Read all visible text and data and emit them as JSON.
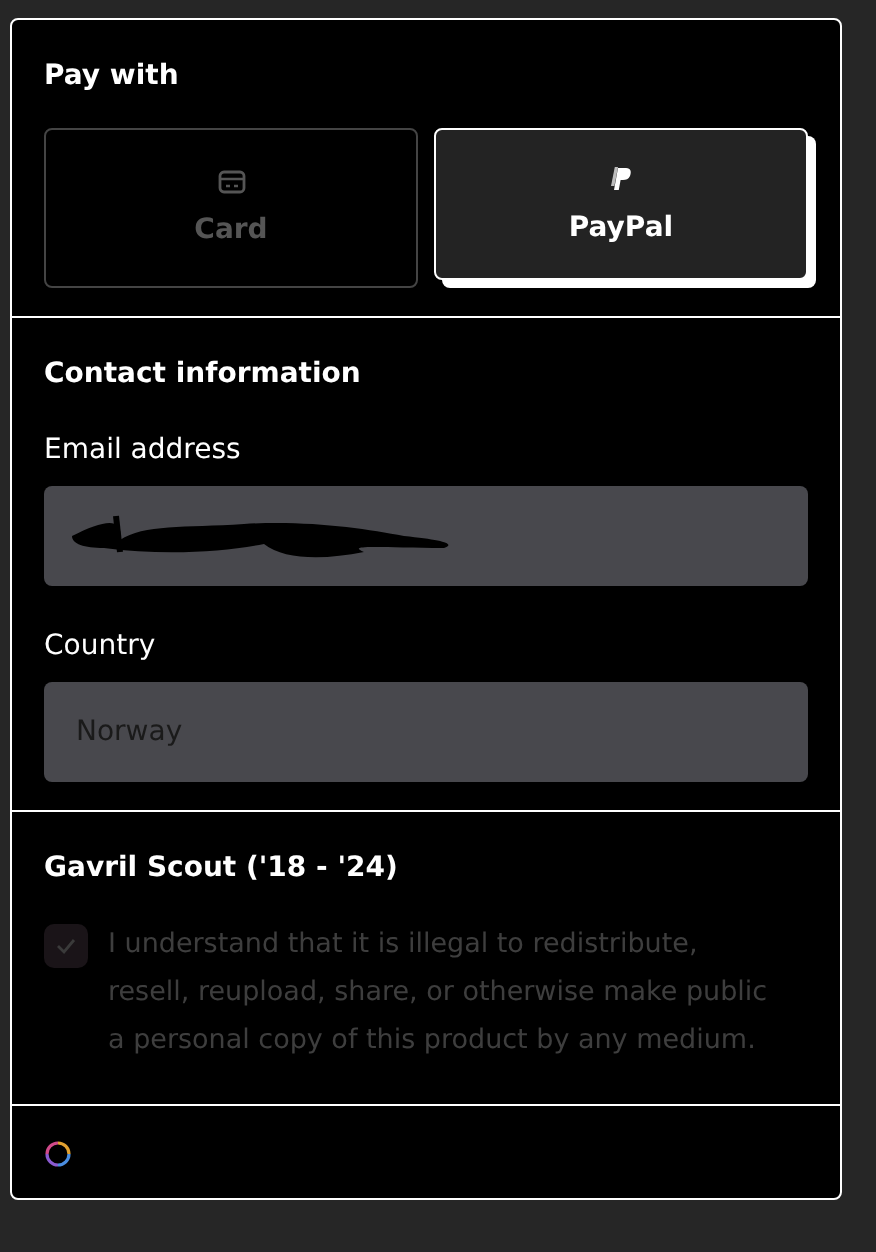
{
  "pay_with": {
    "title": "Pay with",
    "methods": [
      {
        "kind": "card",
        "label": "Card",
        "selected": false
      },
      {
        "kind": "paypal",
        "label": "PayPal",
        "selected": true
      }
    ]
  },
  "contact": {
    "title": "Contact information",
    "fields": [
      {
        "kind": "redacted",
        "label": "Email address"
      },
      {
        "kind": "text",
        "label": "Country",
        "value": "Norway"
      }
    ]
  },
  "product": {
    "title": "Gavril Scout ('18 - '24)",
    "agreement": {
      "checked": true,
      "disabled": true,
      "text": "I understand that it is illegal to redistribute, resell, reupload, share, or otherwise make public a personal copy of this product by any medium."
    }
  },
  "footer": {
    "loading": true
  }
}
